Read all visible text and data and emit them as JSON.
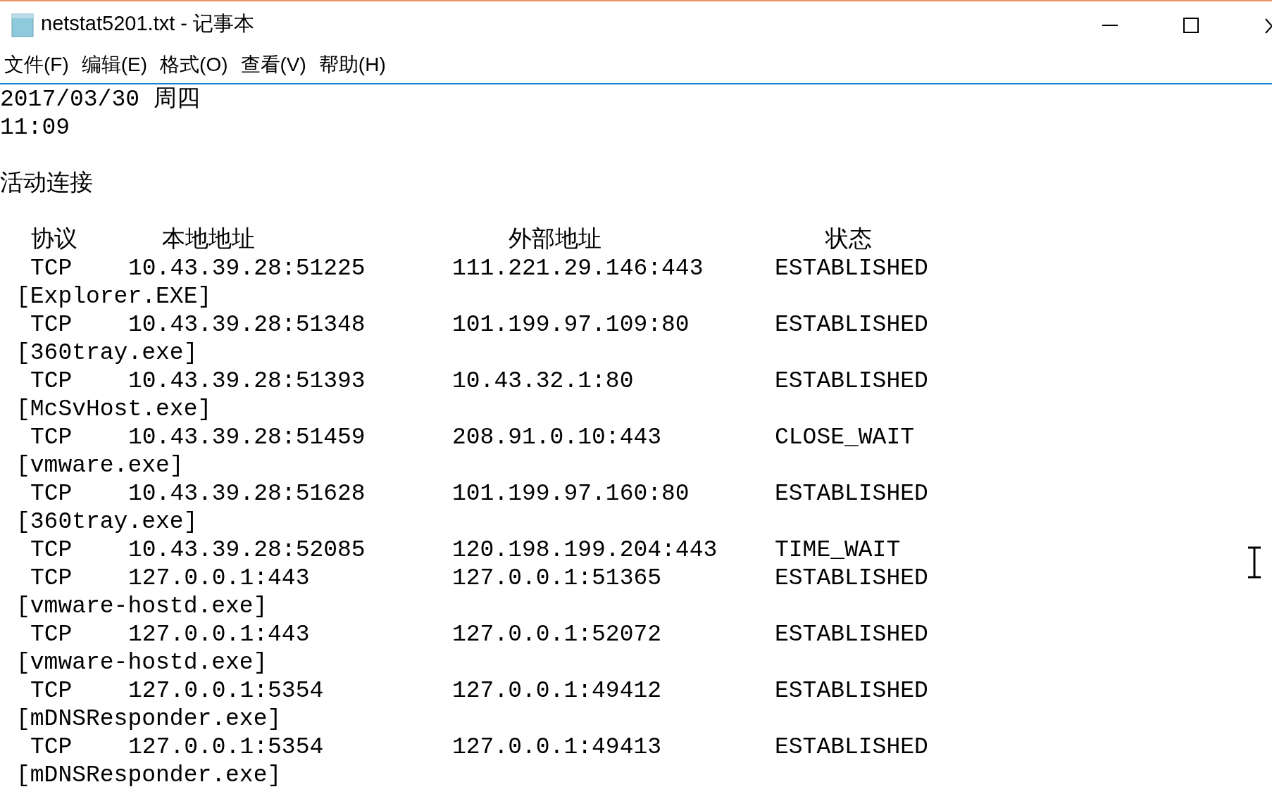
{
  "window": {
    "title": "netstat5201.txt - 记事本"
  },
  "menu": [
    {
      "label": "文件(F)"
    },
    {
      "label": "编辑(E)"
    },
    {
      "label": "格式(O)"
    },
    {
      "label": "查看(V)"
    },
    {
      "label": "帮助(H)"
    }
  ],
  "document": {
    "date": "2017/03/30 周四",
    "time": "11:09",
    "heading": "活动连接",
    "columns": [
      "协议",
      "本地地址",
      "外部地址",
      "状态"
    ],
    "rows": [
      {
        "protocol": "TCP",
        "local": "10.43.39.28:51225",
        "foreign": "111.221.29.146:443",
        "state": "ESTABLISHED",
        "process": "[Explorer.EXE]"
      },
      {
        "protocol": "TCP",
        "local": "10.43.39.28:51348",
        "foreign": "101.199.97.109:80",
        "state": "ESTABLISHED",
        "process": "[360tray.exe]"
      },
      {
        "protocol": "TCP",
        "local": "10.43.39.28:51393",
        "foreign": "10.43.32.1:80",
        "state": "ESTABLISHED",
        "process": "[McSvHost.exe]"
      },
      {
        "protocol": "TCP",
        "local": "10.43.39.28:51459",
        "foreign": "208.91.0.10:443",
        "state": "CLOSE_WAIT",
        "process": "[vmware.exe]"
      },
      {
        "protocol": "TCP",
        "local": "10.43.39.28:51628",
        "foreign": "101.199.97.160:80",
        "state": "ESTABLISHED",
        "process": "[360tray.exe]"
      },
      {
        "protocol": "TCP",
        "local": "10.43.39.28:52085",
        "foreign": "120.198.199.204:443",
        "state": "TIME_WAIT"
      },
      {
        "protocol": "TCP",
        "local": "127.0.0.1:443",
        "foreign": "127.0.0.1:51365",
        "state": "ESTABLISHED",
        "process": "[vmware-hostd.exe]"
      },
      {
        "protocol": "TCP",
        "local": "127.0.0.1:443",
        "foreign": "127.0.0.1:52072",
        "state": "ESTABLISHED",
        "process": "[vmware-hostd.exe]"
      },
      {
        "protocol": "TCP",
        "local": "127.0.0.1:5354",
        "foreign": "127.0.0.1:49412",
        "state": "ESTABLISHED",
        "process": "[mDNSResponder.exe]"
      },
      {
        "protocol": "TCP",
        "local": "127.0.0.1:5354",
        "foreign": "127.0.0.1:49413",
        "state": "ESTABLISHED",
        "process": "[mDNSResponder.exe]"
      }
    ]
  }
}
